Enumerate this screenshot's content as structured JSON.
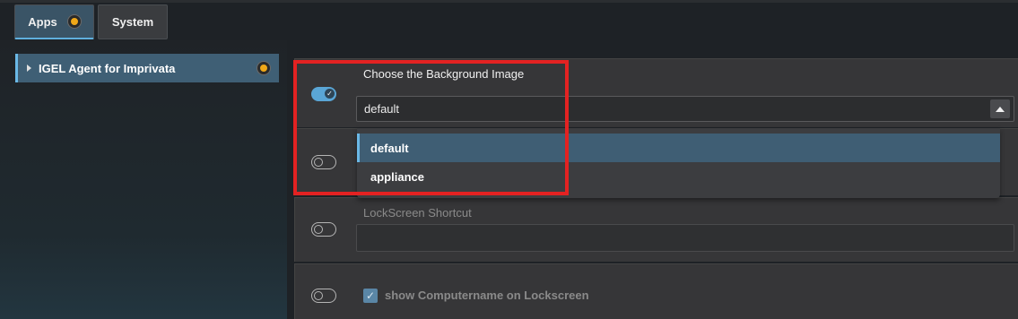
{
  "tabs": [
    {
      "label": "Apps",
      "has_status": true
    },
    {
      "label": "System",
      "has_status": false
    }
  ],
  "tree": {
    "item_label": "IGEL Agent for Imprivata"
  },
  "settings": {
    "background_image": {
      "label": "Choose the Background Image",
      "value": "default",
      "enabled": true,
      "options": [
        "default",
        "appliance"
      ],
      "selected_option": "default"
    },
    "second_toggle": {
      "enabled": false
    },
    "lockscreen_shortcut": {
      "label": "LockScreen Shortcut",
      "value": "",
      "enabled": false
    },
    "show_computername": {
      "label": "show Computername on Lockscreen",
      "checked": true,
      "enabled": false
    }
  },
  "colors": {
    "accent": "#5aa6d6",
    "status_dot": "#f0a818",
    "highlight_box": "#e32222"
  }
}
